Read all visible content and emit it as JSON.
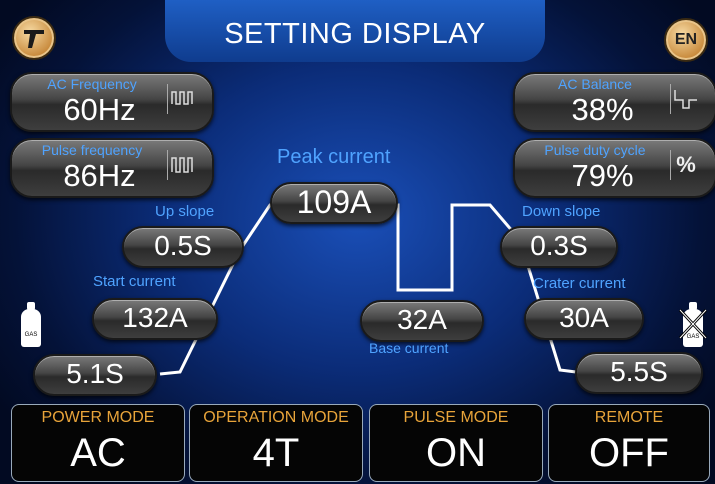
{
  "header": {
    "title": "SETTING DISPLAY",
    "lang": "EN"
  },
  "ac_frequency": {
    "label": "AC Frequency",
    "value": "60Hz"
  },
  "pulse_frequency": {
    "label": "Pulse frequency",
    "value": "86Hz"
  },
  "ac_balance": {
    "label": "AC Balance",
    "value": "38%"
  },
  "pulse_duty": {
    "label": "Pulse duty cycle",
    "value": "79%",
    "unit": "%"
  },
  "peak": {
    "label": "Peak current",
    "value": "109A"
  },
  "up_slope": {
    "label": "Up slope",
    "value": "0.5S"
  },
  "start_current": {
    "label": "Start current",
    "value": "132A"
  },
  "pre_gas": {
    "value": "5.1S"
  },
  "base": {
    "label": "Base current",
    "value": "32A"
  },
  "down_slope": {
    "label": "Down slope",
    "value": "0.3S"
  },
  "crater_current": {
    "label": "Crater current",
    "value": "30A"
  },
  "post_gas": {
    "value": "5.5S"
  },
  "gas_icon": {
    "text": "GAS"
  },
  "modes": [
    {
      "label": "POWER MODE",
      "value": "AC"
    },
    {
      "label": "OPERATION MODE",
      "value": "4T"
    },
    {
      "label": "PULSE MODE",
      "value": "ON"
    },
    {
      "label": "REMOTE",
      "value": "OFF"
    }
  ],
  "colors": {
    "accent": "#4fa3ff",
    "mode_label": "#e8a43a",
    "line": "#ffffff"
  }
}
